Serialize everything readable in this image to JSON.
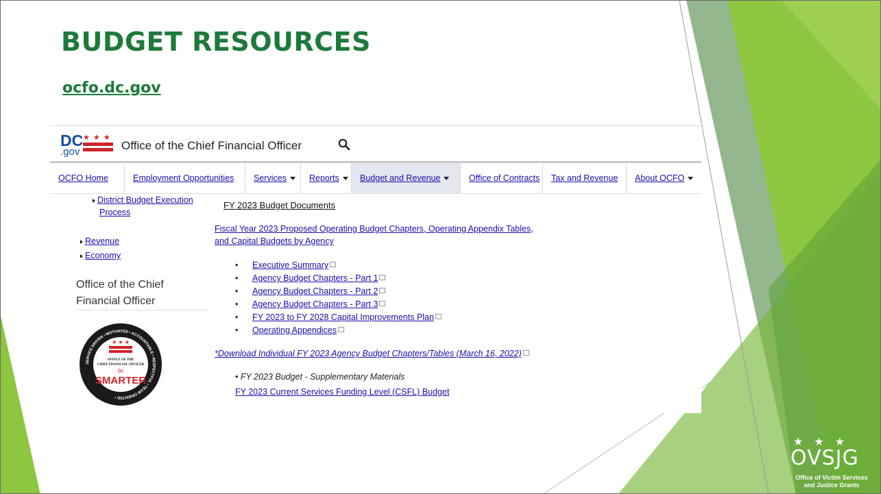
{
  "slide": {
    "title": "BUDGET RESOURCES",
    "site_link": "ocfo.dc.gov"
  },
  "browser": {
    "logo_dc": "DC",
    "logo_gov": ".gov",
    "logo_stars": "★ ★ ★",
    "office_name": "Office of the Chief Financial Officer",
    "nav": [
      {
        "label": "OCFO Home",
        "dropdown": false,
        "active": false
      },
      {
        "label": "Employment Opportunities",
        "dropdown": false,
        "active": false
      },
      {
        "label": "Services",
        "dropdown": true,
        "active": false
      },
      {
        "label": "Reports",
        "dropdown": true,
        "active": false
      },
      {
        "label": "Budget and Revenue",
        "dropdown": true,
        "active": true
      },
      {
        "label": "Office of Contracts",
        "dropdown": false,
        "active": false
      },
      {
        "label": "Tax and Revenue",
        "dropdown": false,
        "active": false
      },
      {
        "label": "About OCFO",
        "dropdown": true,
        "active": false
      }
    ],
    "sidebar": {
      "district_link": "District Budget Execution",
      "district_link_2": "Process",
      "revenue": "Revenue",
      "economy": "Economy",
      "heading_line1": "Office of the Chief",
      "heading_line2": "Financial Officer"
    },
    "seal": {
      "ring_text": "SERVICE DRIVEN • MOTIVATED • ACCOUNTABLE • RESPECTFUL • TEAM ORIENTED •",
      "center_line1": "OFFICE OF THE",
      "center_line2": "CHIEF FINANCIAL OFFICER",
      "be": "be",
      "smarter": "SMARTER"
    },
    "content": {
      "heading": "FY 2023 Budget Documents",
      "main_link_1": "Fiscal Year 2023 Proposed Operating Budget Chapters, Operating Appendix Tables,",
      "main_link_2": "and Capital Budgets by Agency",
      "bullets": [
        "Executive Summary",
        "Agency Budget Chapters - Part 1",
        "Agency Budget Chapters - Part 2",
        "Agency Budget Chapters - Part 3",
        "FY 2023 to FY 2028 Capital Improvements Plan",
        "Operating Appendices"
      ],
      "download_link": "*Download Individual FY 2023 Agency Budget Chapters/Tables (March 16, 2022)",
      "supp_title": "FY 2023 Budget - Supplementary Materials",
      "supp_link": "FY 2023 Current Services Funding Level (CSFL) Budget"
    }
  },
  "branding": {
    "ovsjg_stars": "★★★",
    "ovsjg": "OVSJG",
    "ovsjg_sub_1": "Office of Victim Services",
    "ovsjg_sub_2": "and Justice Grants"
  },
  "colors": {
    "title_green": "#1d7a3a",
    "link_blue": "#1a0dab",
    "dc_red": "#d2232a",
    "dc_blue": "#0d4fa0",
    "deco_green_light": "#8dc63f",
    "deco_green_dark": "#4d8f2a"
  }
}
